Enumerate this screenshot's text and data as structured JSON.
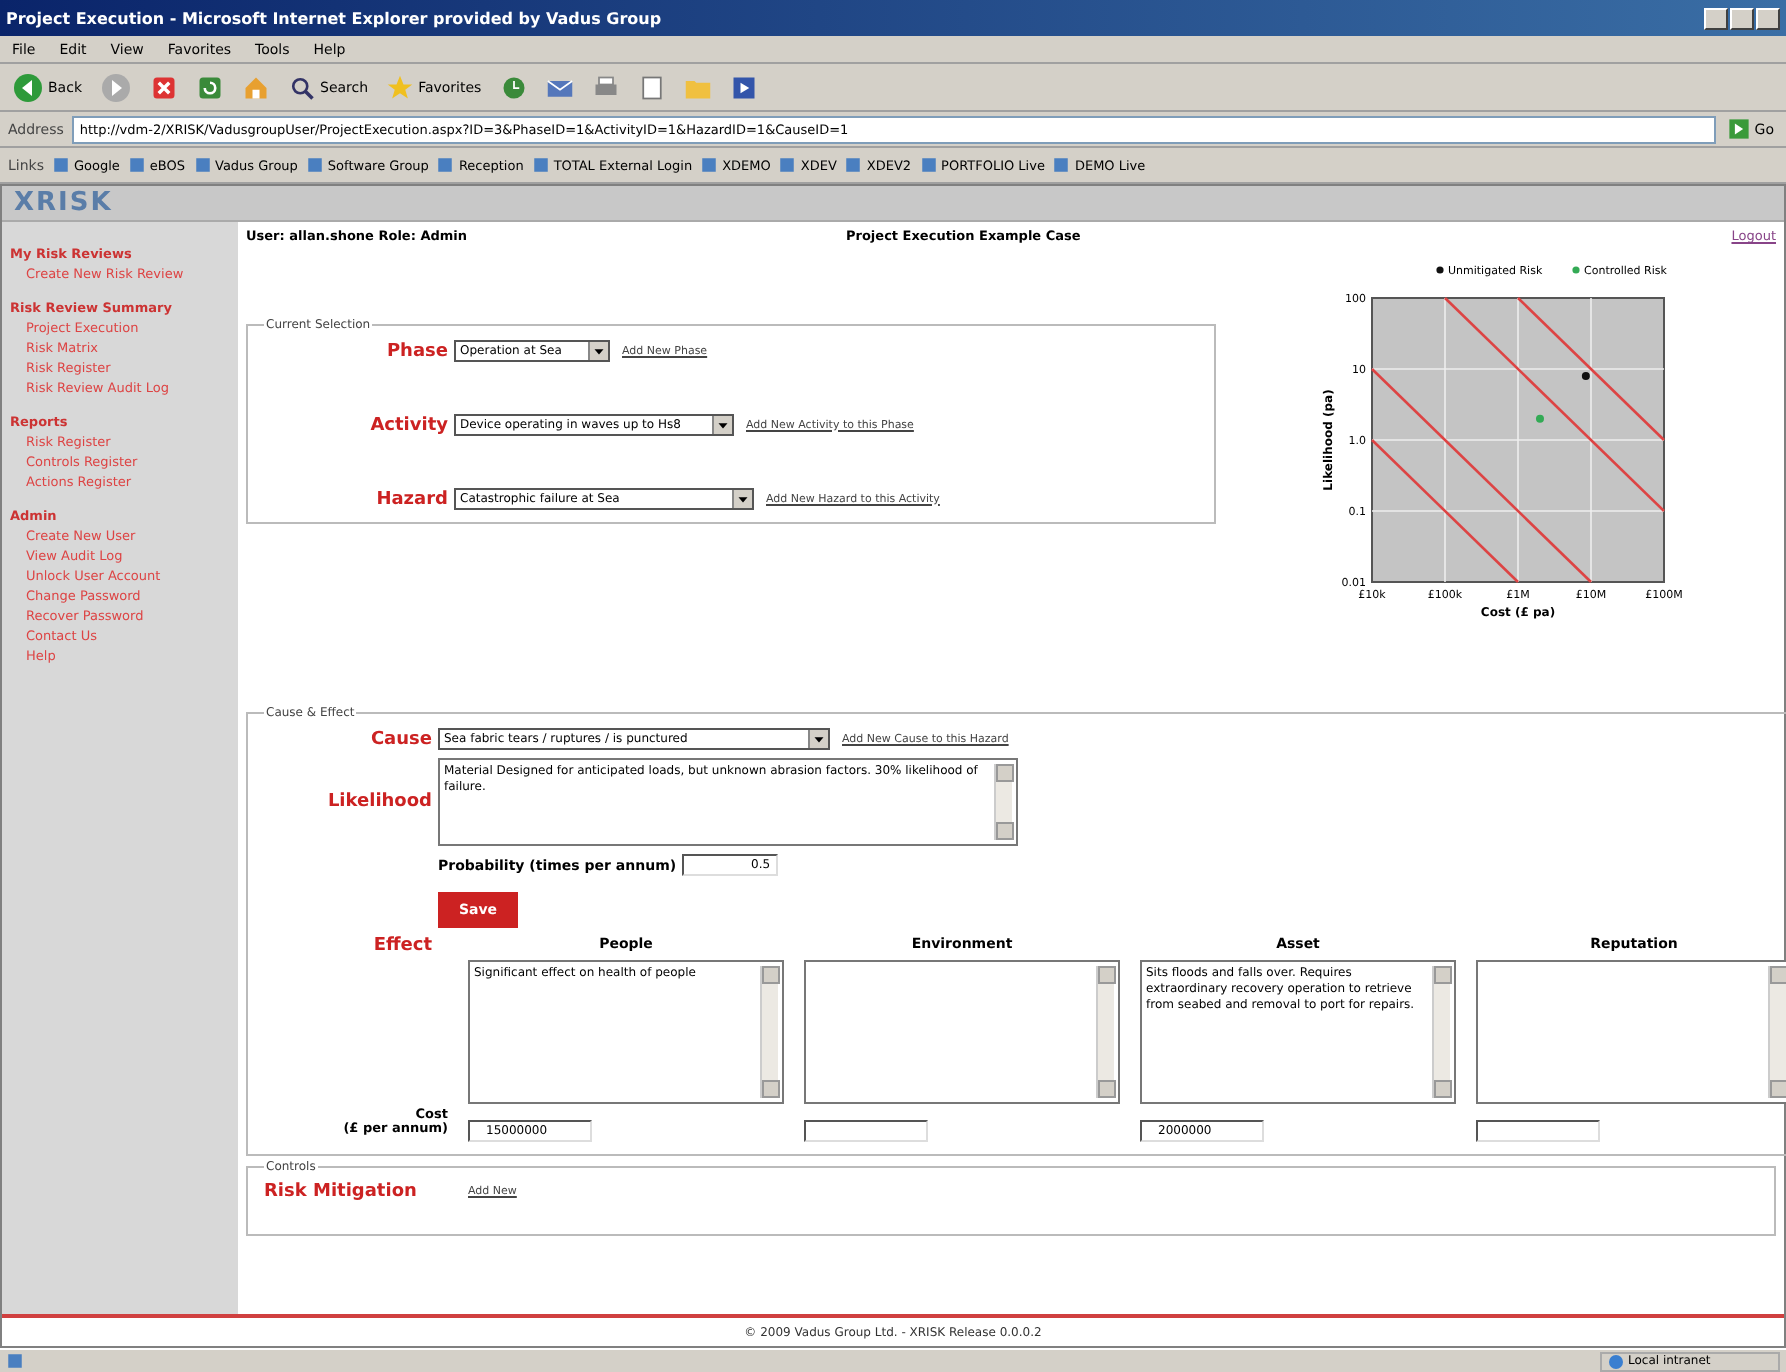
{
  "window": {
    "title": "Project Execution - Microsoft Internet Explorer provided by Vadus Group"
  },
  "menu": [
    "File",
    "Edit",
    "View",
    "Favorites",
    "Tools",
    "Help"
  ],
  "toolbar": [
    {
      "kind": "back",
      "label": "Back"
    },
    {
      "kind": "forward"
    },
    {
      "kind": "stop"
    },
    {
      "kind": "refresh"
    },
    {
      "kind": "home"
    },
    {
      "kind": "search",
      "label": "Search"
    },
    {
      "kind": "favorites",
      "label": "Favorites"
    },
    {
      "kind": "history"
    },
    {
      "kind": "mail"
    },
    {
      "kind": "print"
    },
    {
      "kind": "edit"
    },
    {
      "kind": "folder"
    },
    {
      "kind": "media"
    }
  ],
  "address": {
    "label": "Address",
    "value": "http://vdm-2/XRISK/VadusgroupUser/ProjectExecution.aspx?ID=3&PhaseID=1&ActivityID=1&HazardID=1&CauseID=1",
    "go": "Go"
  },
  "links": {
    "label": "Links",
    "items": [
      "Google",
      "eBOS",
      "Vadus Group",
      "Software Group",
      "Reception",
      "TOTAL External Login",
      "XDEMO",
      "XDEV",
      "XDEV2",
      "PORTFOLIO Live",
      "DEMO Live"
    ]
  },
  "app": {
    "brand": "XRISK",
    "user_label": "User:",
    "user": "allan.shone",
    "role_label": "Role:",
    "role": "Admin",
    "case_title": "Project Execution Example Case",
    "logout": "Logout"
  },
  "sidebar": [
    {
      "heading": "My Risk Reviews",
      "items": [
        "Create New Risk Review"
      ]
    },
    {
      "heading": "Risk Review Summary",
      "items": [
        "Project Execution",
        "Risk Matrix",
        "Risk Register",
        "Risk Review Audit Log"
      ]
    },
    {
      "heading": "Reports",
      "items": [
        "Risk Register",
        "Controls Register",
        "Actions Register"
      ]
    },
    {
      "heading": "Admin",
      "items": [
        "Create New User",
        "View Audit Log",
        "Unlock User Account",
        "Change Password",
        "Recover Password",
        "Contact Us",
        "Help"
      ]
    }
  ],
  "selection": {
    "legend": "Current Selection",
    "rows": [
      {
        "label": "Phase",
        "value": "Operation at Sea",
        "link": "Add New Phase"
      },
      {
        "label": "Activity",
        "value": "Device operating in waves up to Hs8",
        "link": "Add New Activity to this Phase"
      },
      {
        "label": "Hazard",
        "value": "Catastrophic failure at Sea",
        "link": "Add New Hazard to this Activity"
      }
    ]
  },
  "risk_chart": {
    "xlabel": "Cost (£ pa)",
    "ylabel": "Likelihood (pa)",
    "legend": [
      {
        "name": "Unmitigated Risk",
        "color": "#111111"
      },
      {
        "name": "Controlled Risk",
        "color": "#33aa55"
      }
    ],
    "x_labels": [
      "£10k",
      "£100k",
      "£1M",
      "£10M",
      "£100M"
    ],
    "y_labels": [
      "100",
      "10",
      "1.0",
      "0.1",
      "0.01"
    ]
  },
  "cause_effect": {
    "legend": "Cause & Effect",
    "cause_label": "Cause",
    "cause": "Sea fabric tears / ruptures / is punctured",
    "cause_link": "Add New Cause to this Hazard",
    "likelihood_label": "Likelihood",
    "likelihood": "Material Designed for anticipated loads, but unknown abrasion factors. 30% likelihood of failure.",
    "probability_label": "Probability (times per annum)",
    "probability": "0.5",
    "save": "Save",
    "effect_label": "Effect",
    "cost_label": "Cost",
    "cost_unit": "(£ per annum)",
    "effects": [
      {
        "heading": "People",
        "text": "Significant effect on health of people",
        "cost": "15000000"
      },
      {
        "heading": "Environment"
      },
      {
        "heading": "Asset",
        "text": "Sits floods and falls over. Requires extraordinary recovery operation to retrieve from seabed and removal to port for repairs.",
        "cost": "2000000"
      },
      {
        "heading": "Reputation"
      }
    ]
  },
  "controls": {
    "legend": "Controls",
    "label": "Risk Mitigation",
    "link": "Add New"
  },
  "footer": "© 2009 Vadus Group Ltd. - XRISK Release 0.0.0.2",
  "status_bar": {
    "zone": "Local intranet"
  }
}
